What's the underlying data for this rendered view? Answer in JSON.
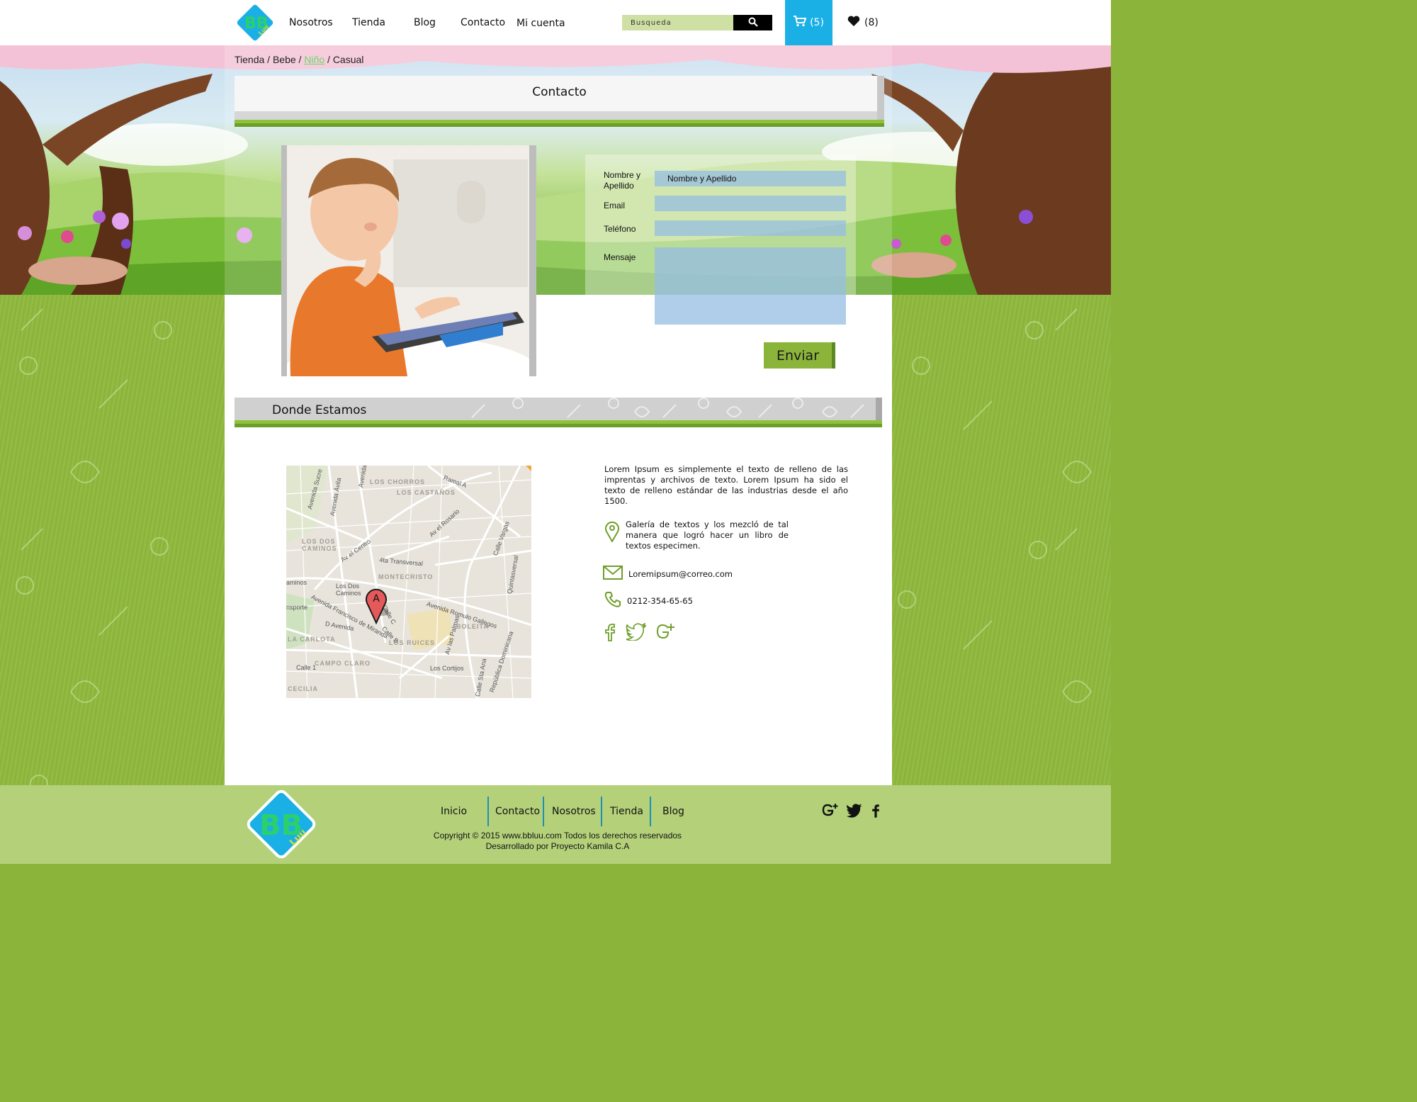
{
  "header": {
    "nav": [
      "Nosotros",
      "Tienda",
      "Blog",
      "Contacto",
      "Mi cuenta"
    ],
    "search_placeholder": "Busqueda",
    "cart_count": "(5)",
    "wishlist_count": "(8)"
  },
  "breadcrumb": {
    "items": [
      "Tienda",
      "Bebe",
      "Niño",
      "Casual"
    ],
    "separator": " / "
  },
  "contact": {
    "title": "Contacto",
    "form": {
      "name_label": "Nombre y Apellido",
      "name_placeholder": "Nombre y Apellido",
      "email_label": "Email",
      "phone_label": "Teléfono",
      "message_label": "Mensaje",
      "submit_label": "Enviar"
    }
  },
  "location": {
    "title": "Donde Estamos",
    "description": "Lorem Ipsum es simplemente el texto de relleno de las imprentas y archivos de texto. Lorem Ipsum ha sido el texto de relleno estándar de las industrias desde el año 1500.",
    "address": "Galería de textos y los mezcló de tal manera que logró hacer un libro de textos especimen.",
    "email": "Loremipsum@correo.com",
    "phone": "0212-354-65-65",
    "map_labels": {
      "los_chorros": "LOS CHORROS",
      "los_castanos": "LOS CASTAÑOS",
      "los_dos_caminos": "LOS DOS CAMINOS",
      "montecristo": "MONTECRISTO",
      "boleita": "BOLEITA",
      "la_carlota": "LA CARLOTA",
      "los_ruices": "LOS RUICES",
      "campo_claro": "CAMPO CLARO",
      "cecilia": "CECILIA",
      "av_sucre": "Avenida Sucre",
      "av_avila": "Avenida Ávila",
      "av_el_centro": "Av el Centro",
      "av_rosario": "Av el Rosario",
      "transversal": "4ta Transversal",
      "av_francisco": "Avenida Francisco de Miranda",
      "av_romulo": "Avenida Romulo Gallegos",
      "av_las_palmas": "Av las Palmas",
      "metro_dos_caminos": "Los Dos Caminos",
      "metro_cortijos": "Los Cortijos",
      "calle_1": "Calle 1",
      "marker": "A",
      "ramal": "Ramal A",
      "caminos": "aminos",
      "transporte": "nsporte",
      "d_avenida": "D Avenida",
      "calle_b": "Calle B",
      "calle_c": "Calle C",
      "calle_vargas": "Calle Vargas",
      "quinta": "Quintasversal",
      "avenida_top": "Avenida",
      "republica": "República Dominicana",
      "calle_sta_ana": "Calle Sta Ana"
    }
  },
  "footer": {
    "nav": [
      "Inicio",
      "Contacto",
      "Nosotros",
      "Tienda",
      "Blog"
    ],
    "copyright_line1": "Copyright © 2015 www.bbluu.com Todos los derechos reservados",
    "copyright_line2": "Desarrollado por Proyecto Kamila C.A"
  },
  "brand": {
    "logo_letters": "BB",
    "logo_word": "Luu"
  },
  "colors": {
    "accent_blue": "#1ab0e6",
    "accent_green": "#8bb43a",
    "footer_bg": "#b4d17a"
  }
}
